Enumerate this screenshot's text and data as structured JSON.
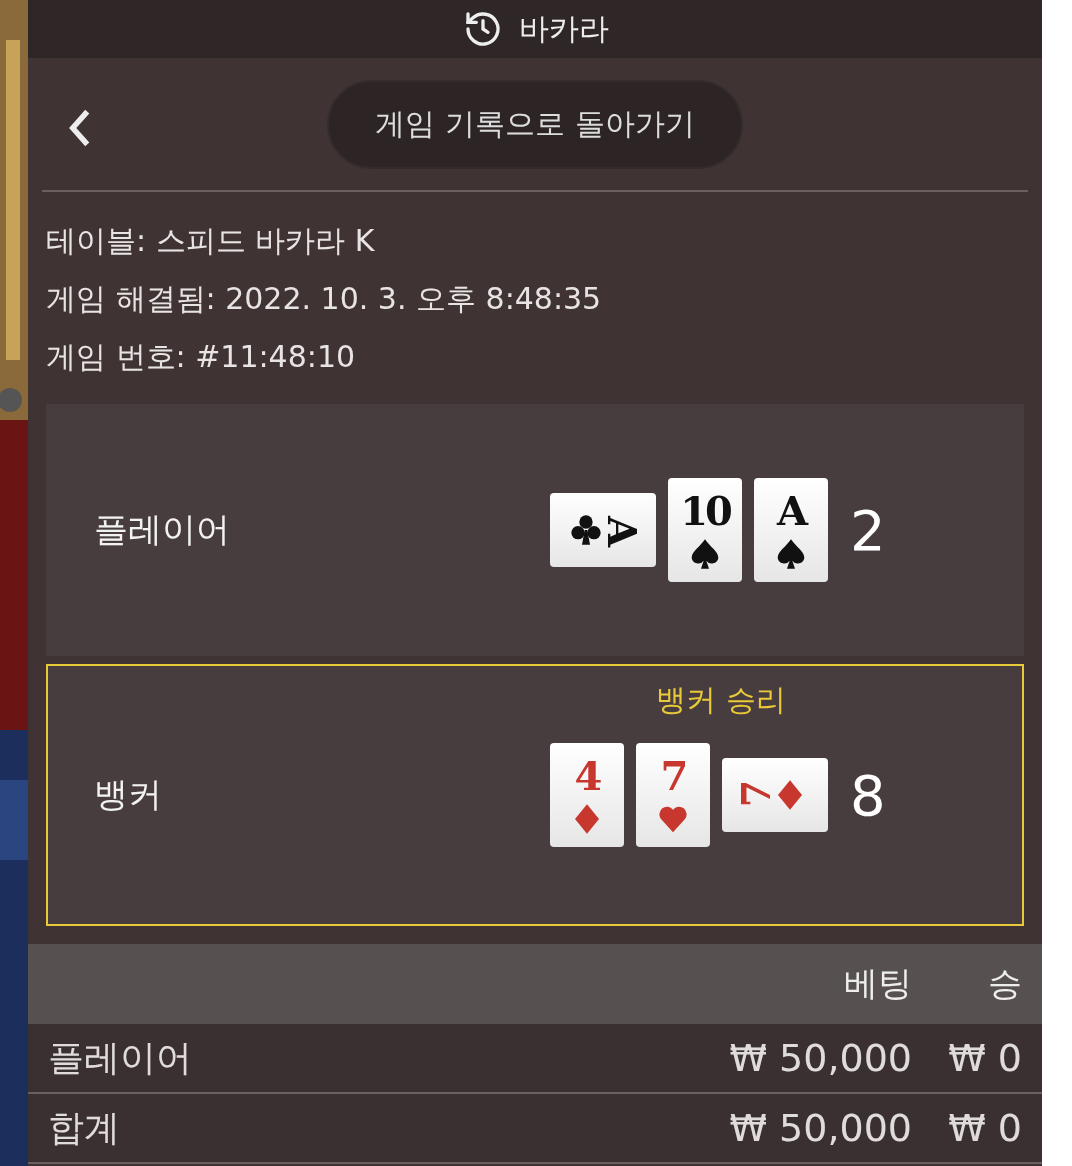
{
  "header": {
    "title": "바카라"
  },
  "nav": {
    "back_button": "게임 기록으로 돌아가기"
  },
  "info": [
    "테이블: 스피드 바카라 K",
    "게임 해결됨: 2022. 10. 3. 오후 8:48:35",
    "게임 번호: #11:48:10"
  ],
  "hands": [
    {
      "label": "플레이어",
      "winner": false,
      "score": "2",
      "cards": [
        {
          "rank": "A",
          "kind": "club",
          "rotated": true,
          "reversed": true
        },
        {
          "rank": "10",
          "kind": "spade",
          "rotated": false,
          "reversed": false
        },
        {
          "rank": "A",
          "kind": "spade",
          "rotated": false,
          "reversed": false
        }
      ]
    },
    {
      "label": "뱅커",
      "winner": true,
      "result": "뱅커 승리",
      "score": "8",
      "cards": [
        {
          "rank": "4",
          "kind": "diamond",
          "rotated": false,
          "reversed": false
        },
        {
          "rank": "7",
          "kind": "heart",
          "rotated": false,
          "reversed": false
        },
        {
          "rank": "7",
          "kind": "diamond",
          "rotated": true,
          "reversed": false
        }
      ]
    }
  ],
  "bets": {
    "columns": [
      "베팅",
      "승"
    ],
    "rows": [
      {
        "label": "플레이어",
        "bet": "₩ 50,000",
        "win": "₩ 0"
      },
      {
        "label": "합계",
        "bet": "₩ 50,000",
        "win": "₩ 0"
      }
    ]
  }
}
